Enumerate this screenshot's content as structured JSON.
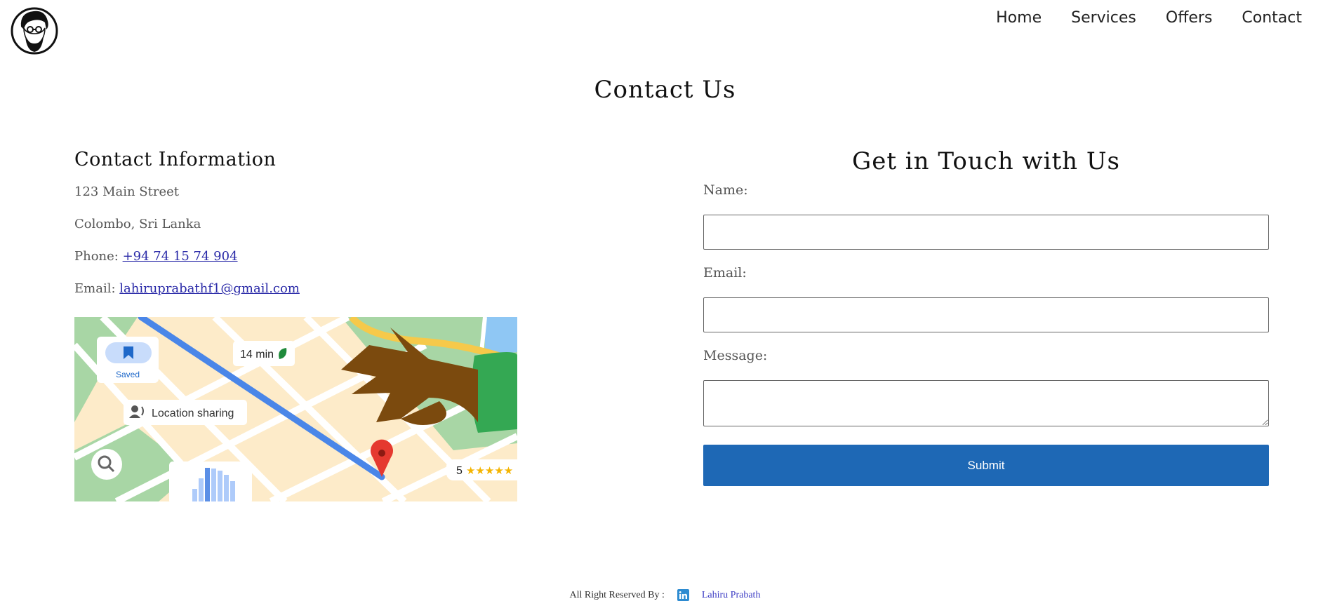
{
  "nav": {
    "items": [
      {
        "label": "Home"
      },
      {
        "label": "Services"
      },
      {
        "label": "Offers"
      },
      {
        "label": "Contact"
      }
    ],
    "logo_icon": "bearded-man-avatar-icon"
  },
  "page": {
    "title": "Contact Us"
  },
  "contact_info": {
    "heading": "Contact Information",
    "address_line1": "123 Main Street",
    "address_line2": "Colombo, Sri Lanka",
    "phone_label": "Phone:",
    "phone": "+94 74 15 74 904",
    "email_label": "Email:",
    "email": "lahiruprabathf1@gmail.com"
  },
  "map": {
    "saved_label": "Saved",
    "eta": "14 min",
    "location_sharing": "Location sharing",
    "rating": "5",
    "stars": "★★★★★"
  },
  "form": {
    "heading": "Get in Touch with Us",
    "name_label": "Name:",
    "email_label": "Email:",
    "message_label": "Message:",
    "submit_label": "Submit",
    "name_value": "",
    "email_value": "",
    "message_value": ""
  },
  "footer": {
    "rights_text": "All Right Reserved By :",
    "author": "Lahiru Prabath",
    "social_icon": "linkedin-icon"
  },
  "colors": {
    "accent": "#1e68b5",
    "link": "#2a2aa8"
  }
}
